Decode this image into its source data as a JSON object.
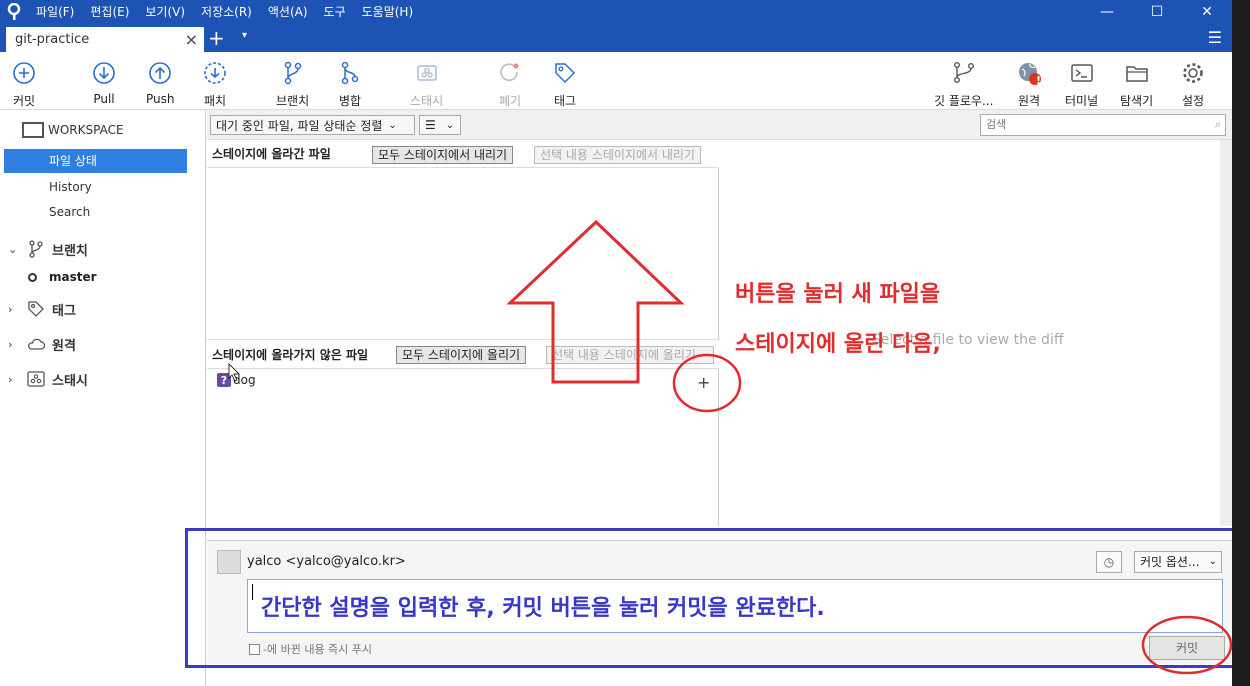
{
  "window": {
    "menu": [
      "파일(F)",
      "편집(E)",
      "보기(V)",
      "저장소(R)",
      "액션(A)",
      "도구",
      "도움말(H)"
    ],
    "controls": [
      "—",
      "☐",
      "✕"
    ]
  },
  "tabs": {
    "active": "git-practice",
    "close": "×",
    "new": "+",
    "dropdown": "▾",
    "menu": "☰"
  },
  "toolbar": {
    "commit": "커밋",
    "pull": "Pull",
    "push": "Push",
    "fetch": "패치",
    "branch": "브랜치",
    "merge": "병합",
    "stash": "스태시",
    "discard": "폐기",
    "tag": "태그",
    "gitflow": "깃 플로우...",
    "remote": "원격",
    "terminal": "터미널",
    "explorer": "탐색기",
    "settings": "설정",
    "remote_badge": "!"
  },
  "sidebar": {
    "workspace": "WORKSPACE",
    "items": [
      "파일 상태",
      "History",
      "Search"
    ],
    "branches": "브랜치",
    "current_branch": "master",
    "tags": "태그",
    "remotes": "원격",
    "stashes": "스태시"
  },
  "filterbar": {
    "pending_filter": "대기 중인 파일, 파일 상태순 정렬",
    "view_icon": "☰",
    "search_placeholder": "검색"
  },
  "staged": {
    "title": "스테이지에 올라간 파일",
    "unstage_all": "모두 스테이지에서 내리기",
    "unstage_selected": "선택 내용 스테이지에서 내리기"
  },
  "unstaged": {
    "title": "스테이지에 올라가지 않은 파일",
    "stage_all": "모두 스테이지에 올리기",
    "stage_selected": "선택 내용 스테이지에 올리기",
    "files": [
      {
        "name": "dog",
        "status": "?"
      }
    ],
    "add": "+"
  },
  "diff": {
    "placeholder": "Select a file to view the diff"
  },
  "commit": {
    "author": "yalco <yalco@yalco.kr>",
    "options": "커밋 옵션...",
    "message": "간단한 설명을 입력한 후, 커밋 버튼을 눌러 커밋을 완료한다.",
    "push_immediately": "-에 바뀐 내용 즉시 푸시",
    "commit_button": "커밋"
  },
  "annotations": {
    "line1": "버튼을 눌러 새 파일을",
    "line2": "스테이지에 올린 다음,"
  },
  "colors": {
    "accent": "#1d53b4",
    "selection": "#2f7fe0",
    "annotation_red": "#e12c2c",
    "annotation_blue": "#3c3cc0"
  }
}
